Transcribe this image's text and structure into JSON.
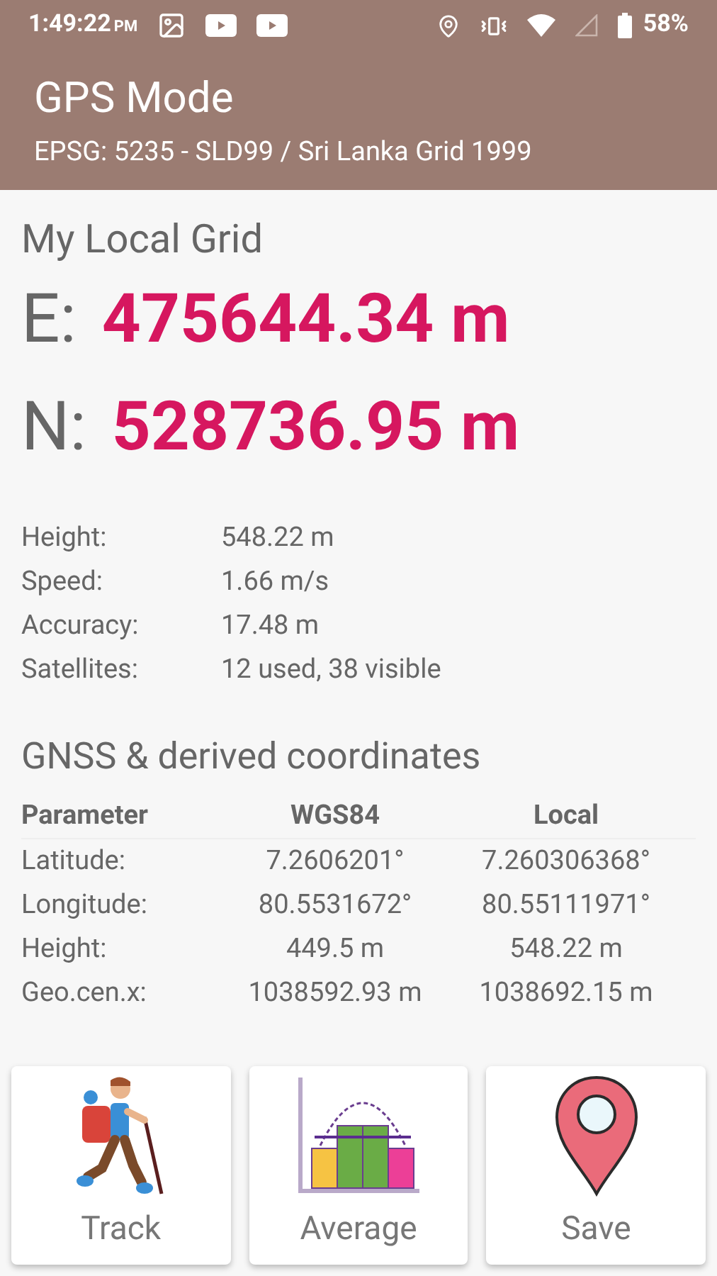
{
  "status_bar": {
    "time": "1:49:22",
    "ampm": "PM",
    "battery": "58%"
  },
  "app_bar": {
    "title": "GPS Mode",
    "subtitle": "EPSG: 5235 - SLD99 / Sri Lanka Grid 1999"
  },
  "local_grid": {
    "heading": "My Local Grid",
    "coordinates": [
      {
        "axis": "E:",
        "value": "475644.34 m"
      },
      {
        "axis": "N:",
        "value": "528736.95 m"
      }
    ],
    "details": [
      {
        "label": "Height:",
        "value": "548.22 m"
      },
      {
        "label": "Speed:",
        "value": "1.66 m/s"
      },
      {
        "label": "Accuracy:",
        "value": "17.48 m"
      },
      {
        "label": "Satellites:",
        "value": "12 used, 38 visible"
      }
    ]
  },
  "gnss": {
    "heading": "GNSS & derived coordinates",
    "table": {
      "columns": [
        "Parameter",
        "WGS84",
        "Local"
      ],
      "rows": [
        [
          "Latitude:",
          "7.2606201°",
          "7.260306368°"
        ],
        [
          "Longitude:",
          "80.5531672°",
          "80.55111971°"
        ],
        [
          "Height:",
          "449.5 m",
          "548.22 m"
        ],
        [
          "Geo.cen.x:",
          "1038592.93 m",
          "1038692.15 m"
        ]
      ]
    }
  },
  "actions": [
    {
      "kind": "track",
      "label": "Track"
    },
    {
      "kind": "average",
      "label": "Average"
    },
    {
      "kind": "save",
      "label": "Save"
    }
  ]
}
